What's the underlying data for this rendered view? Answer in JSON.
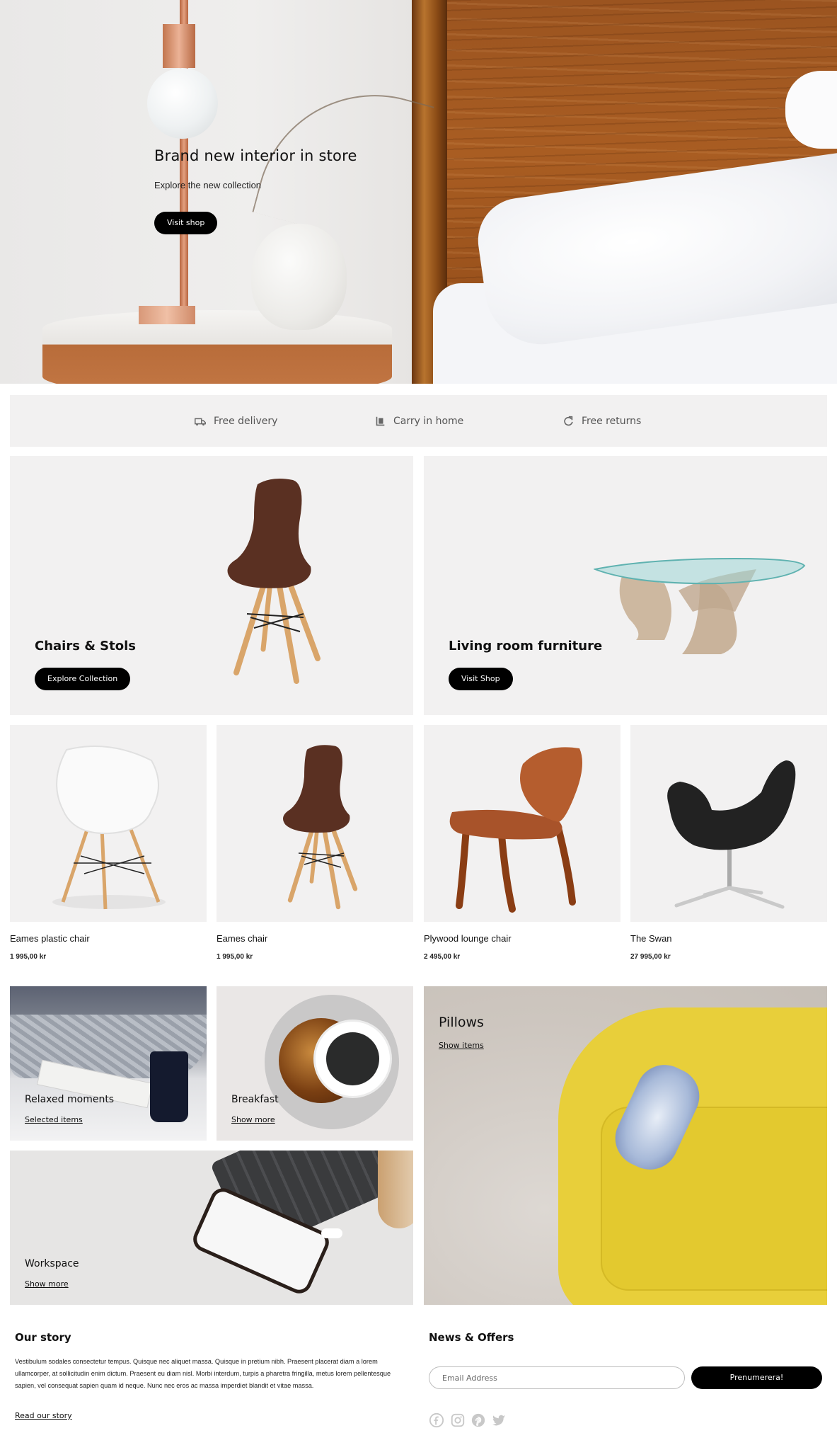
{
  "hero": {
    "title": "Brand new interior in store",
    "subtitle": "Explore the new collection",
    "button_label": "Visit shop"
  },
  "features": [
    {
      "label": "Free delivery",
      "icon": "truck-icon"
    },
    {
      "label": "Carry in home",
      "icon": "dolly-icon"
    },
    {
      "label": "Free returns",
      "icon": "refresh-icon"
    }
  ],
  "banners": [
    {
      "title": "Chairs & Stols",
      "button_label": "Explore Collection"
    },
    {
      "title": "Living room furniture",
      "button_label": "Visit Shop"
    }
  ],
  "products": [
    {
      "name": "Eames plastic chair",
      "price": "1 995,00 kr"
    },
    {
      "name": "Eames chair",
      "price": "1 995,00 kr"
    },
    {
      "name": "Plywood lounge chair",
      "price": "2 495,00 kr"
    },
    {
      "name": "The Swan",
      "price": "27 995,00 kr"
    }
  ],
  "tiles": {
    "relaxed": {
      "title": "Relaxed moments",
      "link": "Selected items"
    },
    "breakfast": {
      "title": "Breakfast",
      "link": "Show more"
    },
    "pillows": {
      "title": "Pillows",
      "link": "Show items"
    },
    "workspace": {
      "title": "Workspace",
      "link": "Show more"
    }
  },
  "footer": {
    "story_heading": "Our story",
    "story_text": "Vestibulum sodales consectetur tempus. Quisque nec aliquet massa. Quisque in pretium nibh. Praesent placerat diam a lorem ullamcorper, at sollicitudin enim dictum. Praesent eu diam nisl. Morbi interdum, turpis a pharetra fringilla, metus lorem pellentesque sapien, vel consequat sapien quam id neque. Nunc nec eros ac massa imperdiet blandit et vitae massa.",
    "story_link": "Read our story",
    "news_heading": "News & Offers",
    "email_placeholder": "Email Address",
    "subscribe_label": "Prenumerera!",
    "social_icons": [
      "facebook-icon",
      "instagram-icon",
      "pinterest-icon",
      "twitter-icon"
    ]
  },
  "colors": {
    "accent": "#000000",
    "panel_bg": "#f2f1f1",
    "muted_text": "#555555",
    "sofa_yellow": "#e8cf3a",
    "social_gray": "#c8c8c8"
  }
}
